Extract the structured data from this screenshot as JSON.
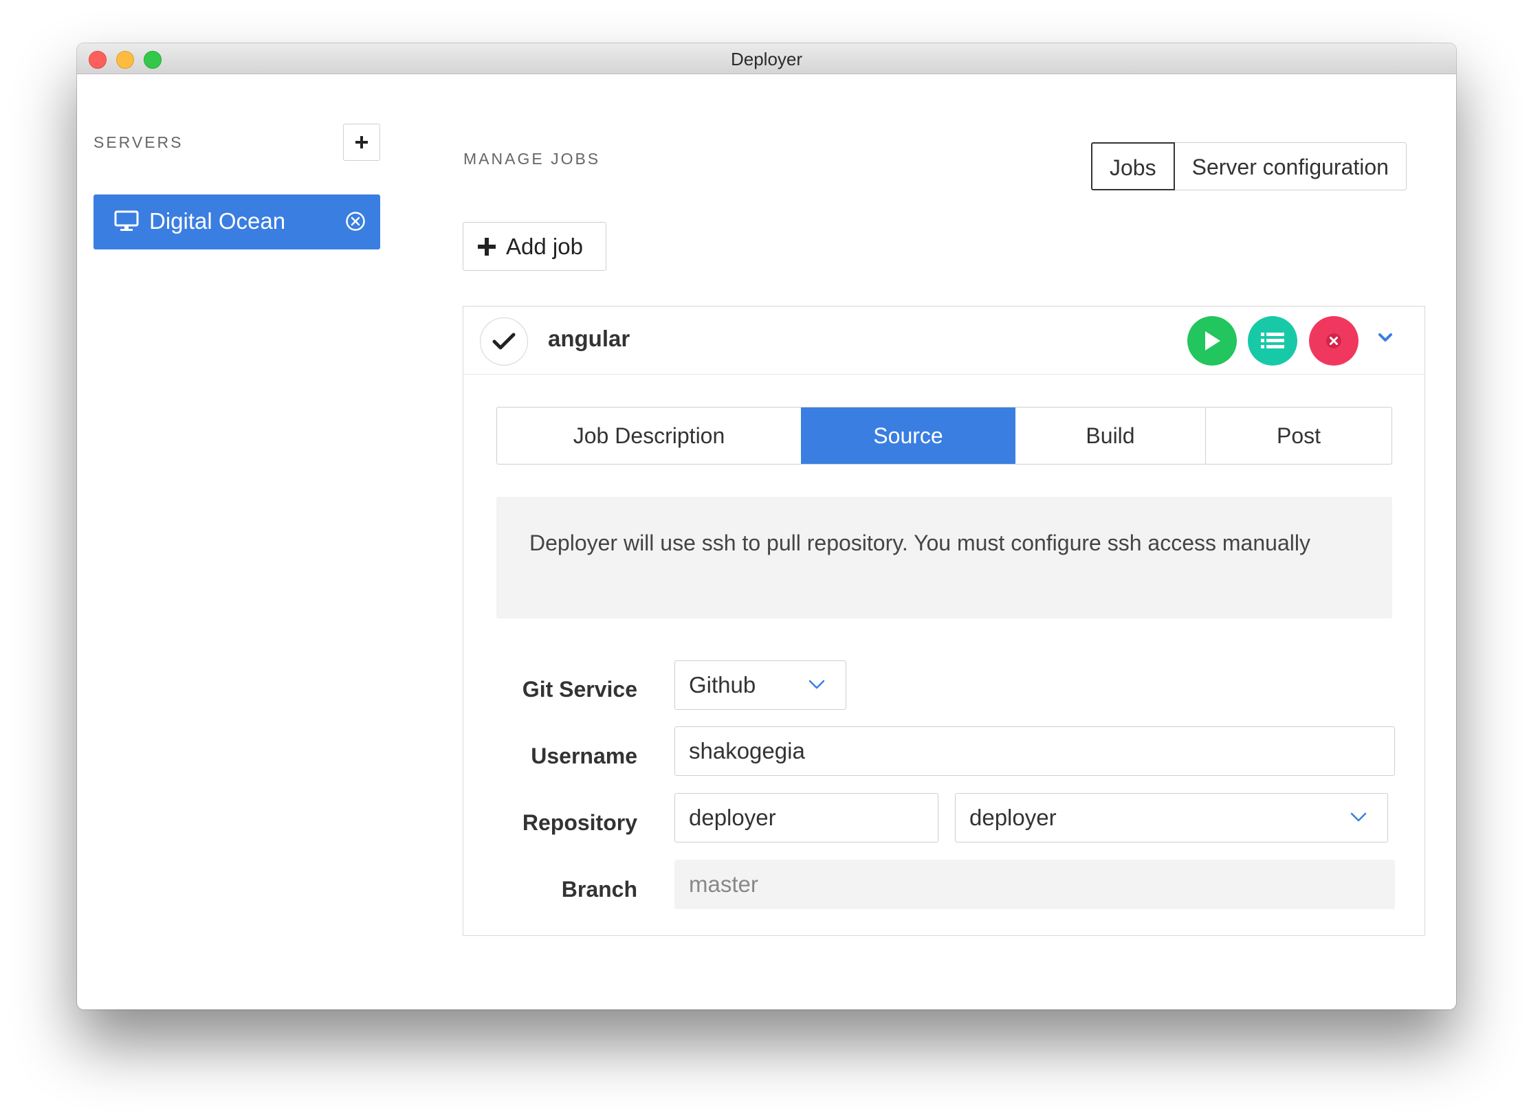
{
  "window": {
    "title": "Deployer"
  },
  "sidebar": {
    "heading": "SERVERS",
    "add_icon": "plus-icon",
    "servers": [
      {
        "name": "Digital Ocean",
        "icon": "monitor-icon",
        "selected": true
      }
    ]
  },
  "main": {
    "heading": "MANAGE JOBS",
    "view_tabs": [
      {
        "label": "Jobs",
        "active": true
      },
      {
        "label": "Server configuration",
        "active": false
      }
    ],
    "add_job_label": "Add job"
  },
  "job": {
    "name": "angular",
    "status_icon": "check-icon",
    "actions": [
      {
        "name": "run",
        "icon": "play-icon",
        "color": "#22c55e"
      },
      {
        "name": "logs",
        "icon": "list-icon",
        "color": "#18c9a8"
      },
      {
        "name": "delete",
        "icon": "close-icon",
        "color": "#f0385f"
      }
    ],
    "tabs": [
      {
        "label": "Job Description",
        "active": false
      },
      {
        "label": "Source",
        "active": true
      },
      {
        "label": "Build",
        "active": false
      },
      {
        "label": "Post",
        "active": false
      }
    ],
    "notice": "Deployer will use ssh to pull repository. You must configure ssh access manually",
    "form": {
      "git_service": {
        "label": "Git Service",
        "value": "Github"
      },
      "username": {
        "label": "Username",
        "value": "shakogegia"
      },
      "repository": {
        "label": "Repository",
        "owner": "deployer",
        "repo": "deployer"
      },
      "branch": {
        "label": "Branch",
        "placeholder": "master"
      }
    }
  },
  "colors": {
    "accent": "#3a7ee1",
    "run": "#22c55e",
    "logs": "#18c9a8",
    "delete": "#f0385f"
  }
}
